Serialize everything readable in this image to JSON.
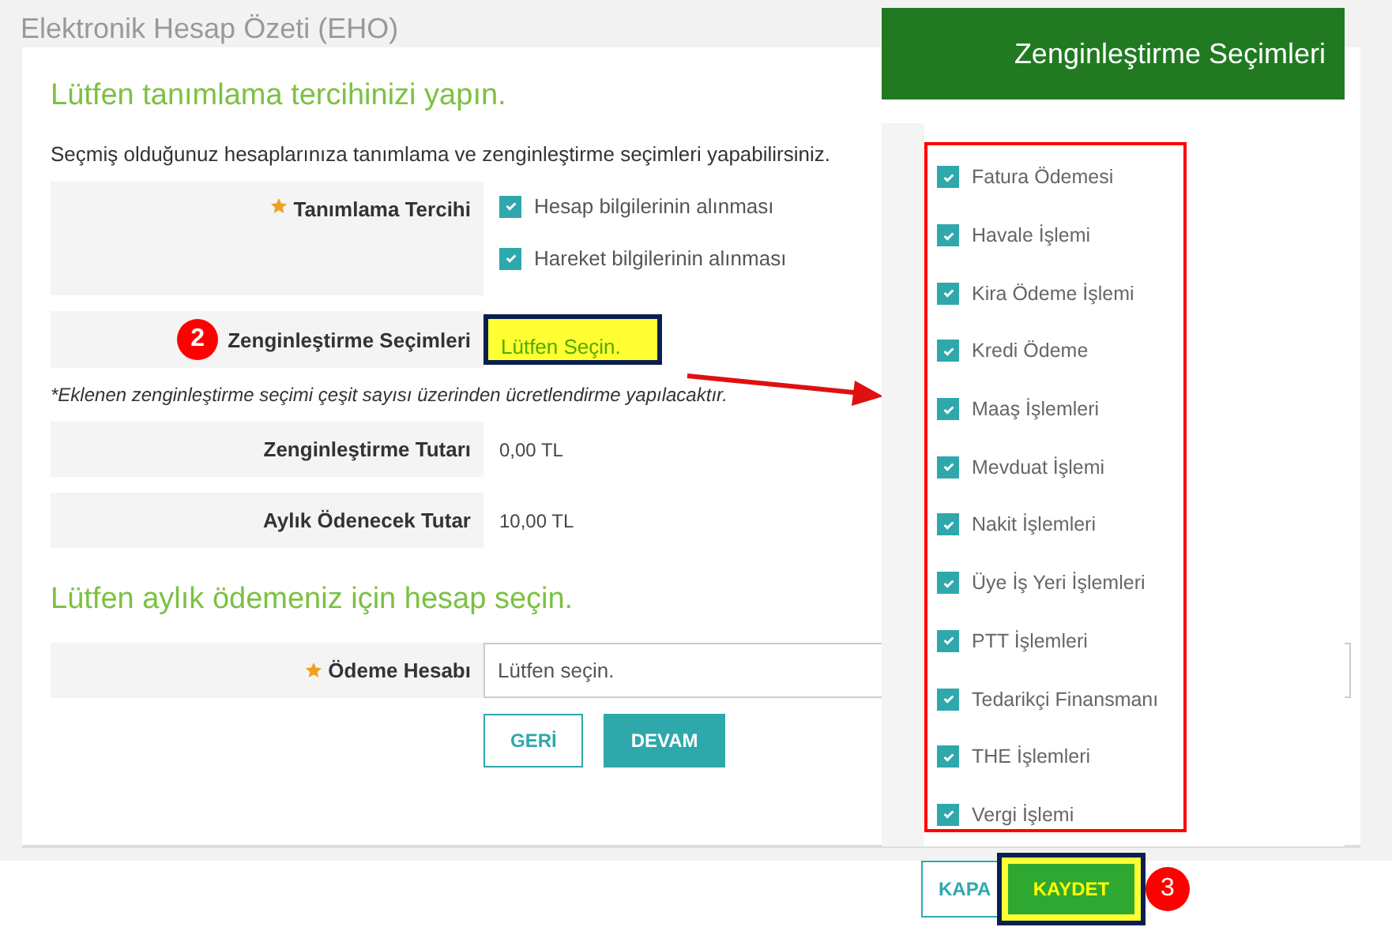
{
  "page": {
    "title": "Elektronik Hesap Özeti (EHO)"
  },
  "form": {
    "heading": "Lütfen tanımlama tercihinizi yapın.",
    "description": "Seçmiş olduğunuz hesaplarınıza tanımlama ve zenginleştirme seçimleri yapabilirsiniz.",
    "preference": {
      "label": "Tanımlama Tercihi",
      "required": true,
      "options": [
        {
          "label": "Hesap bilgilerinin alınması",
          "checked": true
        },
        {
          "label": "Hareket bilgilerinin alınması",
          "checked": true
        }
      ]
    },
    "enrichment": {
      "label": "Zenginleştirme Seçimleri",
      "step": "2",
      "value": "Lütfen Seçin."
    },
    "note": "*Eklenen zenginleştirme seçimi çeşit sayısı üzerinden ücretlendirme yapılacaktır.",
    "summary": [
      {
        "label": "Zenginleştirme Tutarı",
        "value": "0,00 TL"
      },
      {
        "label": "Aylık Ödenecek Tutar",
        "value": "10,00 TL"
      }
    ],
    "payment_heading": "Lütfen aylık ödemeniz için hesap seçin.",
    "payment_account": {
      "label": "Ödeme Hesabı",
      "required": true,
      "placeholder": "Lütfen seçin."
    },
    "buttons": [
      {
        "label": "GERİ",
        "kind": "outline"
      },
      {
        "label": "DEVAM",
        "kind": "primary"
      }
    ]
  },
  "dialog": {
    "title": "Zenginleştirme Seçimleri",
    "options": [
      {
        "label": "Fatura Ödemesi",
        "checked": true
      },
      {
        "label": "Havale İşlemi",
        "checked": true
      },
      {
        "label": "Kira Ödeme İşlemi",
        "checked": true
      },
      {
        "label": "Kredi Ödeme",
        "checked": true
      },
      {
        "label": "Maaş İşlemleri",
        "checked": true
      },
      {
        "label": "Mevduat İşlemi",
        "checked": true
      },
      {
        "label": "Nakit İşlemleri",
        "checked": true
      },
      {
        "label": "Üye İş Yeri İşlemleri",
        "checked": true
      },
      {
        "label": "PTT İşlemleri",
        "checked": true
      },
      {
        "label": "Tedarikçi Finansmanı",
        "checked": true
      },
      {
        "label": "THE İşlemleri",
        "checked": true
      },
      {
        "label": "Vergi İşlemi",
        "checked": true
      }
    ],
    "buttons": [
      {
        "label": "KAPA",
        "kind": "outline"
      },
      {
        "label": "KAYDET",
        "kind": "highlight",
        "step": "3"
      }
    ]
  }
}
